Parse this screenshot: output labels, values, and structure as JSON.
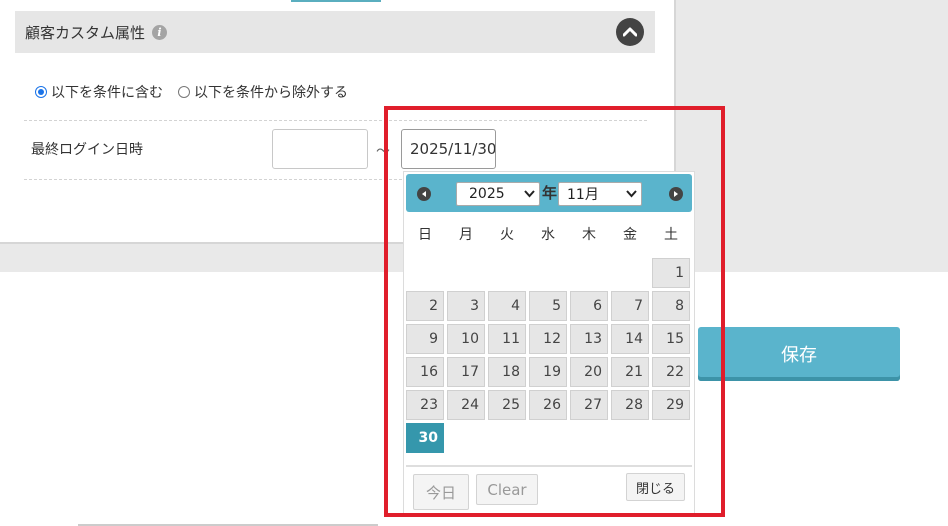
{
  "section": {
    "title": "顧客カスタム属性"
  },
  "condition": {
    "options": [
      {
        "label": "以下を条件に含む",
        "selected": true
      },
      {
        "label": "以下を条件から除外する",
        "selected": false
      }
    ]
  },
  "field": {
    "label": "最終ログイン日時",
    "from_value": "",
    "to_value": "2025/11/30",
    "separator": "～"
  },
  "save_button": {
    "label": "保存"
  },
  "datepicker": {
    "year": "2025",
    "year_suffix": "年",
    "month": "11月",
    "weekdays": [
      "日",
      "月",
      "火",
      "水",
      "木",
      "金",
      "土"
    ],
    "days": [
      "1",
      "2",
      "3",
      "4",
      "5",
      "6",
      "7",
      "8",
      "9",
      "10",
      "11",
      "12",
      "13",
      "14",
      "15",
      "16",
      "17",
      "18",
      "19",
      "20",
      "21",
      "22",
      "23",
      "24",
      "25",
      "26",
      "27",
      "28",
      "29",
      "30"
    ],
    "first_weekday_index": 6,
    "selected_day": "30",
    "today_label": "今日",
    "clear_label": "Clear",
    "close_label": "閉じる"
  },
  "colors": {
    "accent": "#5ab4cc",
    "selected_day": "#3597ac",
    "highlight_frame": "#e01e2b"
  }
}
